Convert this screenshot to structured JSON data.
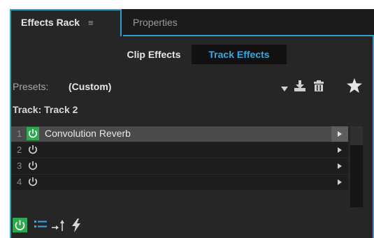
{
  "tabs": [
    {
      "label": "Effects Rack",
      "active": true,
      "icon": "menu-icon"
    },
    {
      "label": "Properties",
      "active": false
    }
  ],
  "segments": {
    "clip": "Clip Effects",
    "track": "Track Effects",
    "selected": "Track Effects"
  },
  "presets": {
    "label": "Presets:",
    "value": "(Custom)"
  },
  "track": {
    "label": "Track: Track 2"
  },
  "rack_slots": [
    {
      "number": "1",
      "name": "Convolution Reverb",
      "enabled": true
    },
    {
      "number": "2",
      "name": "",
      "enabled": false
    },
    {
      "number": "3",
      "name": "",
      "enabled": false
    },
    {
      "number": "4",
      "name": "",
      "enabled": false
    }
  ],
  "colors": {
    "accent": "#2f9ec8",
    "power_on": "#2fa84f",
    "selected_text": "#3aa7e0"
  }
}
